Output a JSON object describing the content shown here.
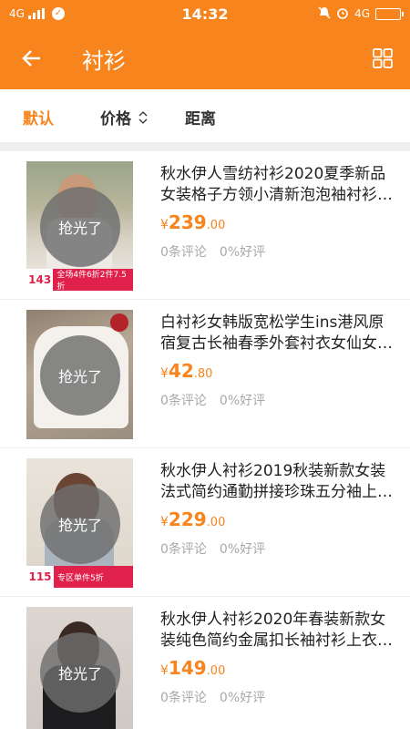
{
  "status_bar": {
    "network_left": "4G",
    "time": "14:32",
    "network_right": "4G"
  },
  "nav": {
    "title": "衬衫",
    "back_icon": "back-arrow-icon",
    "grid_icon": "grid-view-icon"
  },
  "tabs": [
    {
      "label": "默认",
      "active": true
    },
    {
      "label": "价格",
      "active": false
    },
    {
      "label": "距离",
      "active": false
    }
  ],
  "products": [
    {
      "title": "秋水伊人雪纺衬衫2020夏季新品女装格子方领小清新泡泡袖衬衫…",
      "price_int": "239",
      "price_dec": ".00",
      "currency": "¥",
      "reviews": "0条评论",
      "rating": "0%好评",
      "soldout": "抢光了",
      "promo_price": "143",
      "promo_text": "全场4件6折2件7.5折"
    },
    {
      "title": "白衬衫女韩版宽松学生ins港风原宿复古长袖春季外套衬衣女仙女…",
      "price_int": "42",
      "price_dec": ".80",
      "currency": "¥",
      "reviews": "0条评论",
      "rating": "0%好评",
      "soldout": "抢光了"
    },
    {
      "title": "秋水伊人衬衫2019秋装新款女装法式简约通勤拼接珍珠五分袖上…",
      "price_int": "229",
      "price_dec": ".00",
      "currency": "¥",
      "reviews": "0条评论",
      "rating": "0%好评",
      "soldout": "抢光了",
      "promo_price": "115",
      "promo_text": "专区单件5折"
    },
    {
      "title": "秋水伊人衬衫2020年春装新款女装纯色简约金属扣长袖衬衫上衣…",
      "price_int": "149",
      "price_dec": ".00",
      "currency": "¥",
      "reviews": "0条评论",
      "rating": "0%好评",
      "soldout": "抢光了"
    }
  ],
  "colors": {
    "accent": "#f7841c",
    "promo": "#e0214b"
  }
}
